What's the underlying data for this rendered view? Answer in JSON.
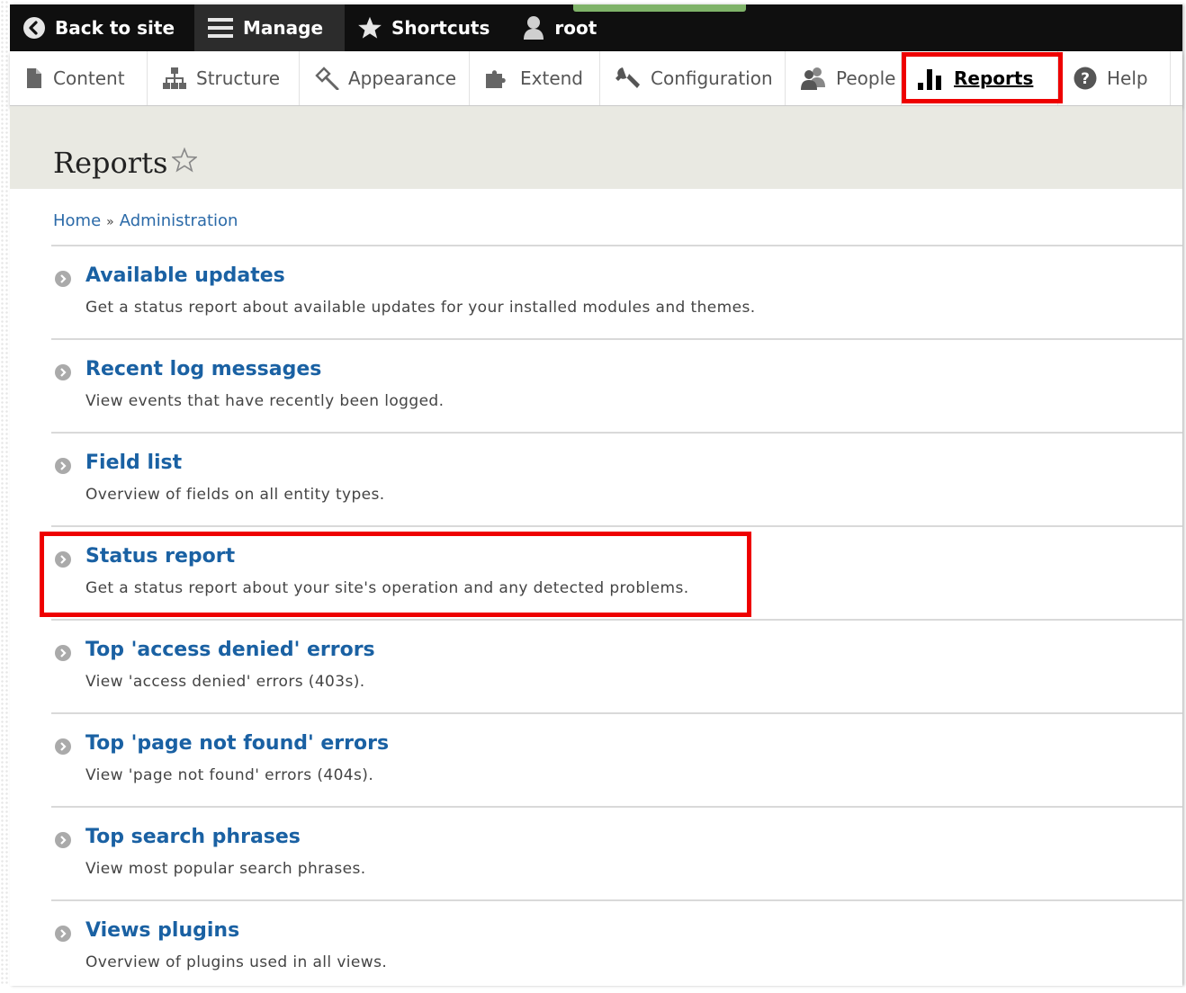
{
  "toolbar": {
    "back_to_site": "Back to site",
    "manage": "Manage",
    "shortcuts": "Shortcuts",
    "user": "root"
  },
  "tray": {
    "items": [
      {
        "label": "Content",
        "icon": "file-icon"
      },
      {
        "label": "Structure",
        "icon": "sitemap-icon"
      },
      {
        "label": "Appearance",
        "icon": "paintbrush-icon"
      },
      {
        "label": "Extend",
        "icon": "puzzle-icon"
      },
      {
        "label": "Configuration",
        "icon": "wrench-icon"
      },
      {
        "label": "People",
        "icon": "people-icon"
      },
      {
        "label": "Reports",
        "icon": "bar-chart-icon",
        "active": true
      },
      {
        "label": "Help",
        "icon": "question-icon"
      }
    ]
  },
  "page": {
    "title": "Reports"
  },
  "breadcrumb": {
    "home": "Home",
    "separator": "»",
    "admin": "Administration"
  },
  "reports": [
    {
      "title": "Available updates",
      "description": "Get a status report about available updates for your installed modules and themes."
    },
    {
      "title": "Recent log messages",
      "description": "View events that have recently been logged."
    },
    {
      "title": "Field list",
      "description": "Overview of fields on all entity types."
    },
    {
      "title": "Status report",
      "description": "Get a status report about your site's operation and any detected problems."
    },
    {
      "title": "Top 'access denied' errors",
      "description": "View 'access denied' errors (403s)."
    },
    {
      "title": "Top 'page not found' errors",
      "description": "View 'page not found' errors (404s)."
    },
    {
      "title": "Top search phrases",
      "description": "View most popular search phrases."
    },
    {
      "title": "Views plugins",
      "description": "Overview of plugins used in all views."
    }
  ],
  "colors": {
    "link": "#1a61a3",
    "highlight": "#ee0000",
    "toolbar": "#0f0f0f"
  }
}
